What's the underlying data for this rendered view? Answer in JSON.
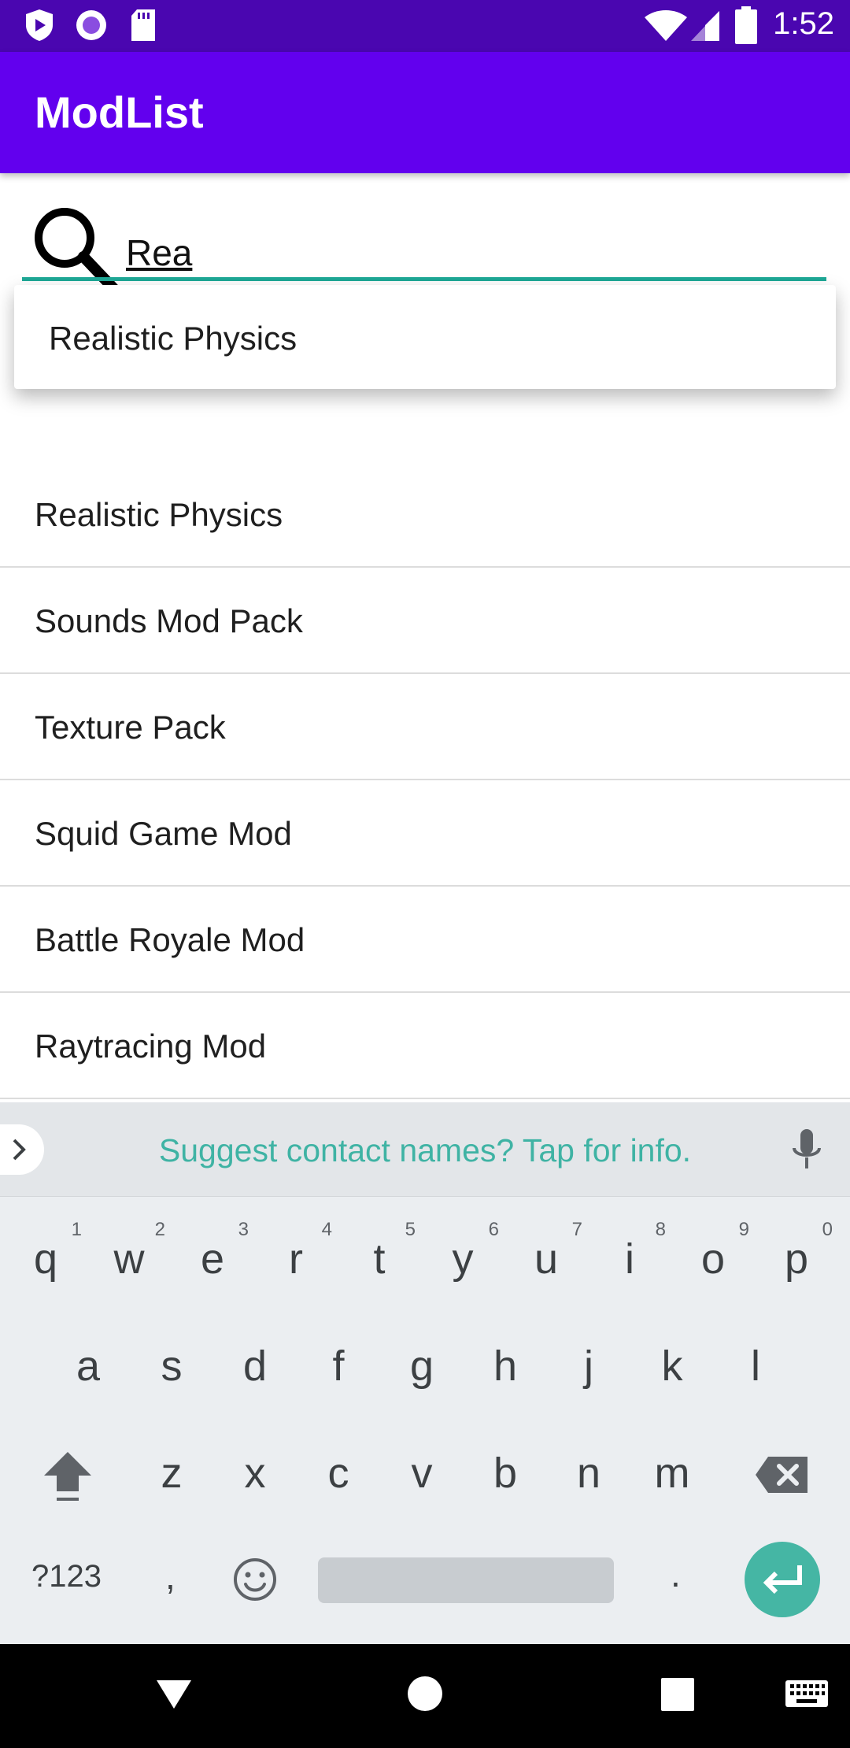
{
  "status_bar": {
    "time": "1:52",
    "left_icons": [
      "shield-play-icon",
      "circle-record-icon",
      "sd-card-icon"
    ],
    "right_icons": [
      "wifi-icon",
      "signal-icon",
      "battery-icon"
    ]
  },
  "app_bar": {
    "title": "ModList",
    "color": "#6200ee"
  },
  "search": {
    "value": "Rea",
    "underline_color": "#1ea896"
  },
  "suggestions": [
    "Realistic Physics"
  ],
  "mods": [
    "Realistic Physics",
    "Sounds Mod Pack",
    "Texture Pack",
    "Squid Game Mod",
    "Battle Royale Mod",
    "Raytracing Mod"
  ],
  "keyboard": {
    "suggestion": "Suggest contact names? Tap for info.",
    "row1": [
      {
        "ch": "q",
        "num": "1"
      },
      {
        "ch": "w",
        "num": "2"
      },
      {
        "ch": "e",
        "num": "3"
      },
      {
        "ch": "r",
        "num": "4"
      },
      {
        "ch": "t",
        "num": "5"
      },
      {
        "ch": "y",
        "num": "6"
      },
      {
        "ch": "u",
        "num": "7"
      },
      {
        "ch": "i",
        "num": "8"
      },
      {
        "ch": "o",
        "num": "9"
      },
      {
        "ch": "p",
        "num": "0"
      }
    ],
    "row2": [
      "a",
      "s",
      "d",
      "f",
      "g",
      "h",
      "j",
      "k",
      "l"
    ],
    "row3": [
      "z",
      "x",
      "c",
      "v",
      "b",
      "n",
      "m"
    ],
    "symbols_label": "?123",
    "comma": ",",
    "period": ".",
    "accent_color": "#45b6a4"
  },
  "nav_bar": {
    "buttons": [
      "back-icon",
      "home-icon",
      "recents-icon",
      "keyboard-switch-icon"
    ]
  }
}
